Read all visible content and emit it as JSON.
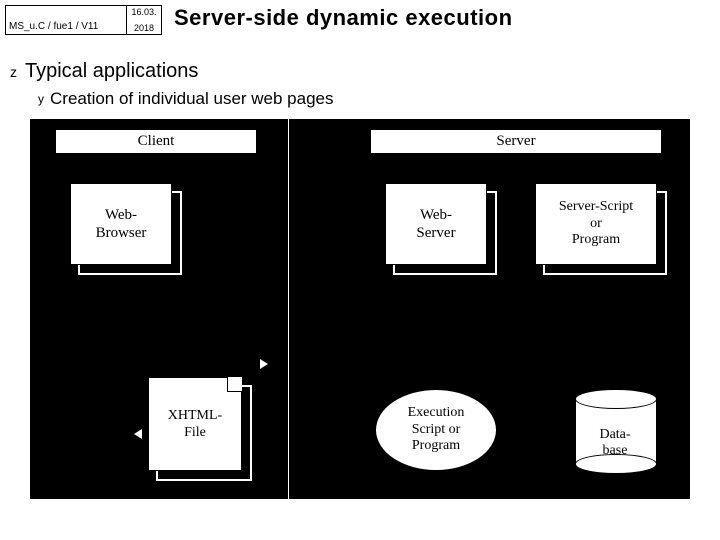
{
  "header": {
    "id_label": "MS_u.C / fue1 / V11",
    "date_top": "16.03.",
    "date_bottom": "2018",
    "title": "Server-side dynamic execution"
  },
  "bullets": {
    "main": "Typical applications",
    "sub": "Creation of individual user web pages"
  },
  "diagram": {
    "zone_client": "Client",
    "zone_server": "Server",
    "web_browser": "Web-\nBrowser",
    "web_server": "Web-\nServer",
    "server_script": "Server-Script\nor\nProgram",
    "xhtml_file": "XHTML-\nFile",
    "exec_script": "Execution\nScript or\nProgram",
    "database": "Data-\nbase"
  }
}
